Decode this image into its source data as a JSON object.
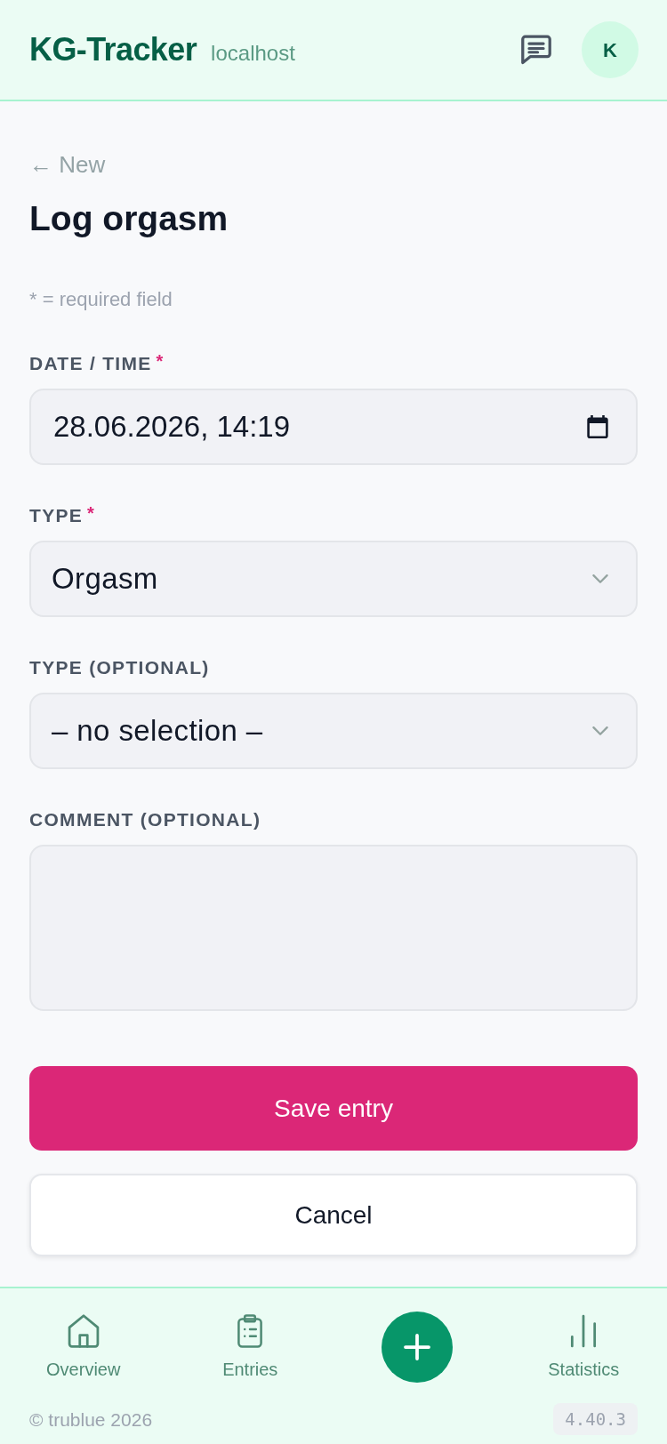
{
  "header": {
    "brand": "KG-Tracker",
    "host": "localhost",
    "avatar": "K"
  },
  "back_link": "← New",
  "page_title": "Log orgasm",
  "required_note": "* = required field",
  "required_marker": "*",
  "fields": [
    {
      "kind": "datetime",
      "label": "DATE / TIME",
      "required": true,
      "value": "28.06.2026, 14:19"
    },
    {
      "kind": "select",
      "label": "TYPE",
      "required": true,
      "value": "Orgasm"
    },
    {
      "kind": "select",
      "label": "TYPE (OPTIONAL)",
      "required": false,
      "value": "– no selection –"
    },
    {
      "kind": "textarea",
      "label": "COMMENT (OPTIONAL)",
      "required": false
    }
  ],
  "buttons": [
    {
      "kind": "primary",
      "label": "Save entry"
    },
    {
      "kind": "secondary",
      "label": "Cancel"
    }
  ],
  "bottom_nav": [
    {
      "kind": "tab",
      "label": "Overview",
      "selected": false
    },
    {
      "kind": "tab",
      "label": "Entries",
      "selected": false
    },
    {
      "kind": "action"
    },
    {
      "kind": "tab",
      "label": "Statistics",
      "selected": false
    }
  ],
  "footer": {
    "copyright": "© trublue 2026",
    "version": "4.40.3"
  }
}
